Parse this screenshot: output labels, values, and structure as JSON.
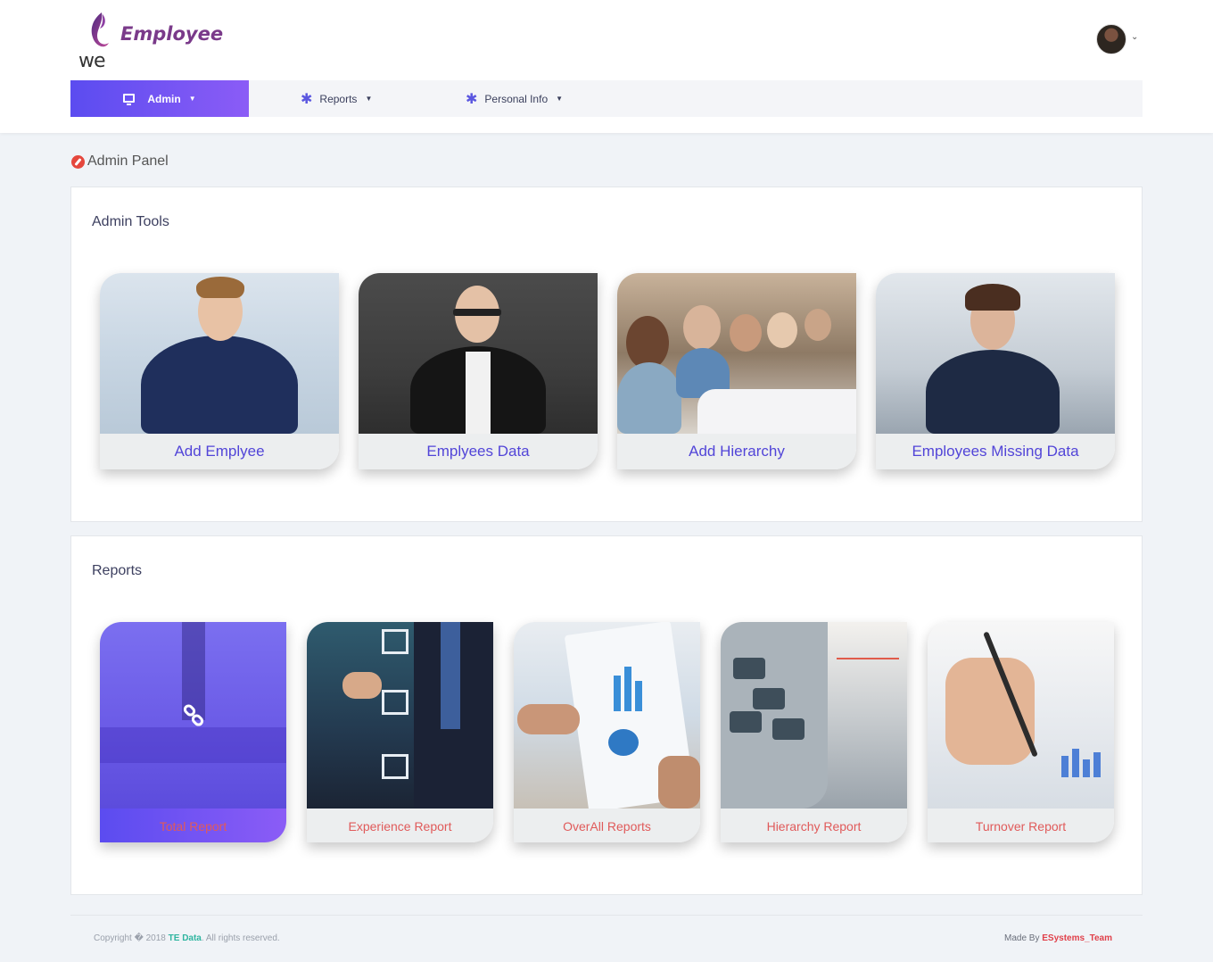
{
  "brand": {
    "name": "Employee",
    "logo_sub": "we"
  },
  "nav": {
    "items": [
      {
        "label": "Admin",
        "icon": "monitor-icon"
      },
      {
        "label": "Reports",
        "icon": "asterisk-icon"
      },
      {
        "label": "Personal Info",
        "icon": "asterisk-icon"
      }
    ]
  },
  "page": {
    "title": "Admin Panel",
    "title_icon": "compass-icon"
  },
  "admin_tools": {
    "title": "Admin Tools",
    "cards": [
      {
        "label": "Add Emplyee"
      },
      {
        "label": "Emplyees Data"
      },
      {
        "label": "Add Hierarchy"
      },
      {
        "label": "Employees Missing Data"
      }
    ]
  },
  "reports": {
    "title": "Reports",
    "cards": [
      {
        "label": "Total Report",
        "active": true
      },
      {
        "label": "Experience Report"
      },
      {
        "label": "OverAll Reports"
      },
      {
        "label": "Hierarchy Report"
      },
      {
        "label": "Turnover Report"
      }
    ]
  },
  "footer": {
    "copyright_prefix": "Copyright � 2018",
    "company": "TE Data",
    "copyright_suffix": ". All rights reserved.",
    "made_by": "Made By",
    "team": "ESystems_Team"
  },
  "colors": {
    "accent": "#5b4cf0",
    "accent2": "#8b5cf6",
    "report_label": "#e05a5a",
    "tool_label": "#5245d8"
  }
}
